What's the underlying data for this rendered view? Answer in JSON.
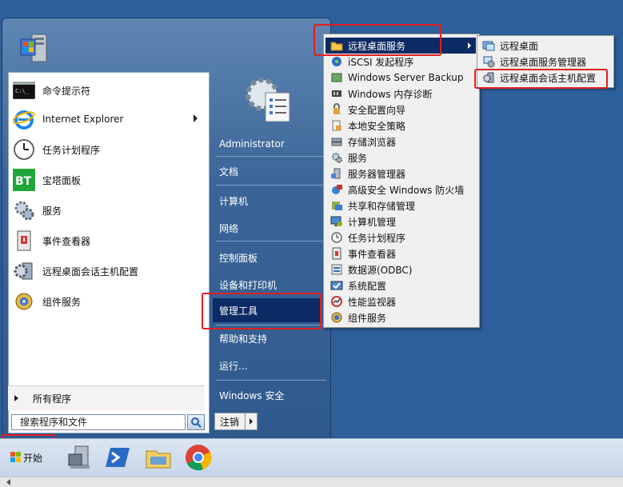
{
  "start_menu": {
    "programs": [
      {
        "label": "命令提示符",
        "icon": "cmd-icon"
      },
      {
        "label": "Internet Explorer",
        "icon": "ie-icon",
        "has_submenu": true
      },
      {
        "label": "任务计划程序",
        "icon": "clock-icon"
      },
      {
        "label": "宝塔面板",
        "icon": "bt-icon"
      },
      {
        "label": "服务",
        "icon": "services-gear-icon"
      },
      {
        "label": "事件查看器",
        "icon": "event-viewer-icon"
      },
      {
        "label": "远程桌面会话主机配置",
        "icon": "rdsh-config-icon"
      },
      {
        "label": "组件服务",
        "icon": "component-services-icon"
      }
    ],
    "all_programs": "所有程序",
    "search_placeholder": "搜索程序和文件",
    "right_items": [
      {
        "label": "Administrator"
      },
      {
        "label": "文档"
      },
      {
        "label": "计算机"
      },
      {
        "label": "网络"
      },
      {
        "label": "控制面板"
      },
      {
        "label": "设备和打印机"
      },
      {
        "label": "管理工具",
        "selected": true
      },
      {
        "label": "帮助和支持"
      },
      {
        "label": "运行..."
      },
      {
        "label": "Windows 安全"
      }
    ],
    "shutdown_label": "注销"
  },
  "admin_tools_menu": [
    {
      "label": "远程桌面服务",
      "icon": "folder-icon",
      "selected": true,
      "has_submenu": true
    },
    {
      "label": "iSCSI 发起程序",
      "icon": "iscsi-icon"
    },
    {
      "label": "Windows Server Backup",
      "icon": "backup-icon"
    },
    {
      "label": "Windows 内存诊断",
      "icon": "memory-diag-icon"
    },
    {
      "label": "安全配置向导",
      "icon": "security-wizard-icon"
    },
    {
      "label": "本地安全策略",
      "icon": "local-policy-icon"
    },
    {
      "label": "存储浏览器",
      "icon": "storage-explorer-icon"
    },
    {
      "label": "服务",
      "icon": "services-icon"
    },
    {
      "label": "服务器管理器",
      "icon": "server-manager-icon"
    },
    {
      "label": "高级安全 Windows 防火墙",
      "icon": "firewall-icon"
    },
    {
      "label": "共享和存储管理",
      "icon": "share-storage-icon"
    },
    {
      "label": "计算机管理",
      "icon": "computer-mgmt-icon"
    },
    {
      "label": "任务计划程序",
      "icon": "task-scheduler-icon"
    },
    {
      "label": "事件查看器",
      "icon": "event-viewer-icon"
    },
    {
      "label": "数据源(ODBC)",
      "icon": "odbc-icon"
    },
    {
      "label": "系统配置",
      "icon": "sysconfig-icon"
    },
    {
      "label": "性能监视器",
      "icon": "perfmon-icon"
    },
    {
      "label": "组件服务",
      "icon": "component-services-icon"
    }
  ],
  "rds_menu": [
    {
      "label": "远程桌面",
      "icon": "remote-desktop-icon"
    },
    {
      "label": "远程桌面服务管理器",
      "icon": "rds-manager-icon"
    },
    {
      "label": "远程桌面会话主机配置",
      "icon": "rdsh-config-icon"
    }
  ],
  "taskbar": {
    "start_label": "开始",
    "pinned": [
      "server-manager-icon",
      "powershell-icon",
      "explorer-icon",
      "chrome-icon"
    ]
  },
  "colors": {
    "desktop": "#2d5f9a",
    "selection": "#0c2a63",
    "highlight": "#e02020"
  }
}
